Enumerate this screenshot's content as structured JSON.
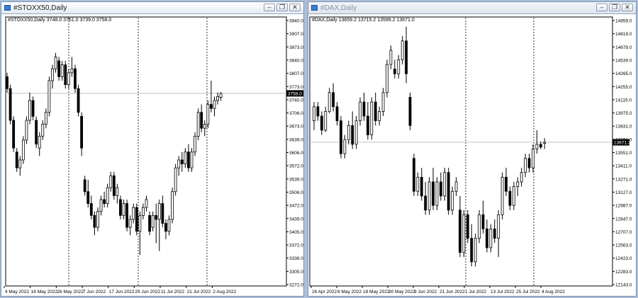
{
  "colors": {
    "desktop": "#abc0d8",
    "chart_bg": "#ffffff",
    "candle": "#000000",
    "grid_separator": "#000000",
    "price_line": "#c0c0c0"
  },
  "windows": [
    {
      "title": "#STOXX50,Daily",
      "info": "#STOXX50,Daily  3748.0 3761.0 3739.0 3758.0",
      "title_buttons": [
        "minimize-icon",
        "restore-icon",
        "close-icon"
      ],
      "price_label": "3758.0",
      "y_ticks": [
        "3940.0",
        "3907.0",
        "3873.0",
        "3840.0",
        "3807.0",
        "3773.0",
        "3740.0",
        "3706.0",
        "3673.0",
        "3639.0",
        "3606.0",
        "3572.0",
        "3539.0",
        "3506.0",
        "3472.0",
        "3439.0",
        "3405.0",
        "3372.0",
        "3338.0",
        "3305.0",
        "3272.0"
      ],
      "x_ticks": [
        "4 May 2022",
        "16 May 2022",
        "26 May 2022",
        "7 Jun 2022",
        "17 Jun 2022",
        "29 Jun 2022",
        "11 Jul 2022",
        "21 Jul 2022",
        "2 Aug 2022"
      ]
    },
    {
      "title": "#DAX,Daily",
      "info": "#DAX,Daily  13659.2 13715.2 13599.2 13671.0",
      "title_buttons": [
        "minimize-icon",
        "restore-icon",
        "close-icon"
      ],
      "price_label": "13671.2",
      "y_ticks": [
        "14959.0",
        "14819.0",
        "14679.0",
        "14539.0",
        "14395.0",
        "14255.0",
        "14115.0",
        "13975.0",
        "13831.0",
        "13691.0",
        "13551.0",
        "13411.0",
        "13271.0",
        "13127.0",
        "12987.0",
        "12847.0",
        "12707.0",
        "12563.0",
        "12423.0",
        "12283.0",
        "12143.0"
      ],
      "x_ticks": [
        "26 Apr 2022",
        "6 May 2022",
        "18 May 2022",
        "30 May 2022",
        "9 Jun 2022",
        "21 Jun 2022",
        "1 Jul 2022",
        "13 Jul 2022",
        "25 Jul 2022",
        "4 Aug 2022"
      ]
    }
  ],
  "chart_data": [
    {
      "type": "candlestick",
      "title": "#STOXX50,Daily",
      "ohlc_header": [
        3748.0,
        3761.0,
        3739.0,
        3758.0
      ],
      "ylim": [
        3272.0,
        3940.0
      ],
      "current_price": 3758.0,
      "bars": [
        [
          3800,
          3810,
          3760,
          3770
        ],
        [
          3770,
          3780,
          3680,
          3690
        ],
        [
          3690,
          3700,
          3610,
          3620
        ],
        [
          3610,
          3620,
          3560,
          3570
        ],
        [
          3570,
          3600,
          3550,
          3590
        ],
        [
          3590,
          3650,
          3580,
          3640
        ],
        [
          3640,
          3700,
          3630,
          3690
        ],
        [
          3690,
          3760,
          3680,
          3740
        ],
        [
          3740,
          3750,
          3690,
          3700
        ],
        [
          3690,
          3700,
          3620,
          3630
        ],
        [
          3620,
          3660,
          3600,
          3650
        ],
        [
          3650,
          3690,
          3640,
          3680
        ],
        [
          3680,
          3720,
          3670,
          3710
        ],
        [
          3710,
          3800,
          3700,
          3790
        ],
        [
          3790,
          3830,
          3770,
          3820
        ],
        [
          3820,
          3860,
          3810,
          3850
        ],
        [
          3840,
          3850,
          3790,
          3800
        ],
        [
          3800,
          3840,
          3790,
          3830
        ],
        [
          3830,
          3840,
          3770,
          3780
        ],
        [
          3780,
          3820,
          3770,
          3810
        ],
        [
          3810,
          3850,
          3800,
          3820
        ],
        [
          3820,
          3830,
          3760,
          3770
        ],
        [
          3770,
          3780,
          3700,
          3710
        ],
        [
          3700,
          3710,
          3600,
          3620
        ],
        [
          3540,
          3550,
          3500,
          3510
        ],
        [
          3510,
          3540,
          3470,
          3480
        ],
        [
          3480,
          3500,
          3440,
          3450
        ],
        [
          3450,
          3460,
          3400,
          3420
        ],
        [
          3420,
          3470,
          3410,
          3460
        ],
        [
          3460,
          3500,
          3450,
          3490
        ],
        [
          3490,
          3510,
          3470,
          3480
        ],
        [
          3480,
          3530,
          3470,
          3520
        ],
        [
          3520,
          3560,
          3510,
          3550
        ],
        [
          3550,
          3560,
          3490,
          3500
        ],
        [
          3500,
          3530,
          3480,
          3520
        ],
        [
          3490,
          3500,
          3440,
          3450
        ],
        [
          3450,
          3490,
          3440,
          3480
        ],
        [
          3480,
          3490,
          3410,
          3420
        ],
        [
          3420,
          3450,
          3400,
          3440
        ],
        [
          3440,
          3480,
          3430,
          3470
        ],
        [
          3470,
          3480,
          3400,
          3410
        ],
        [
          3410,
          3460,
          3350,
          3450
        ],
        [
          3450,
          3480,
          3440,
          3470
        ],
        [
          3470,
          3500,
          3460,
          3490
        ],
        [
          3450,
          3460,
          3400,
          3410
        ],
        [
          3420,
          3460,
          3410,
          3450
        ],
        [
          3450,
          3480,
          3380,
          3440
        ],
        [
          3440,
          3490,
          3360,
          3480
        ],
        [
          3480,
          3500,
          3420,
          3430
        ],
        [
          3430,
          3440,
          3390,
          3410
        ],
        [
          3410,
          3450,
          3400,
          3440
        ],
        [
          3440,
          3520,
          3430,
          3510
        ],
        [
          3510,
          3580,
          3500,
          3570
        ],
        [
          3570,
          3600,
          3550,
          3590
        ],
        [
          3590,
          3610,
          3560,
          3580
        ],
        [
          3580,
          3620,
          3570,
          3610
        ],
        [
          3610,
          3630,
          3560,
          3570
        ],
        [
          3570,
          3620,
          3560,
          3610
        ],
        [
          3610,
          3660,
          3600,
          3650
        ],
        [
          3650,
          3720,
          3640,
          3710
        ],
        [
          3710,
          3730,
          3660,
          3670
        ],
        [
          3670,
          3690,
          3650,
          3680
        ],
        [
          3680,
          3740,
          3670,
          3730
        ],
        [
          3730,
          3790,
          3710,
          3720
        ],
        [
          3720,
          3750,
          3700,
          3740
        ],
        [
          3740,
          3760,
          3730,
          3750
        ],
        [
          3748,
          3761,
          3739,
          3758
        ]
      ]
    },
    {
      "type": "candlestick",
      "title": "#DAX,Daily",
      "ohlc_header": [
        13659.2,
        13715.2,
        13599.2,
        13671.0
      ],
      "ylim": [
        12143.0,
        14959.0
      ],
      "current_price": 13671.2,
      "bars": [
        [
          13900,
          14100,
          13800,
          14050
        ],
        [
          14050,
          14100,
          13900,
          13950
        ],
        [
          13950,
          14000,
          13750,
          13800
        ],
        [
          13800,
          14050,
          13780,
          14000
        ],
        [
          14000,
          14250,
          13980,
          14200
        ],
        [
          14200,
          14300,
          14000,
          14050
        ],
        [
          14050,
          14100,
          13850,
          13900
        ],
        [
          13900,
          13950,
          13500,
          13550
        ],
        [
          13550,
          13750,
          13500,
          13700
        ],
        [
          13700,
          13900,
          13650,
          13850
        ],
        [
          13850,
          14000,
          13600,
          13650
        ],
        [
          13650,
          13950,
          13600,
          13900
        ],
        [
          13900,
          14150,
          13850,
          14100
        ],
        [
          14100,
          14200,
          13900,
          13950
        ],
        [
          13950,
          14100,
          13700,
          13750
        ],
        [
          13750,
          14150,
          13700,
          14100
        ],
        [
          14100,
          14200,
          13850,
          13900
        ],
        [
          13900,
          14050,
          13850,
          14000
        ],
        [
          14000,
          14250,
          13950,
          14200
        ],
        [
          14200,
          14550,
          14150,
          14500
        ],
        [
          14500,
          14700,
          14450,
          14650
        ],
        [
          14450,
          14550,
          14350,
          14400
        ],
        [
          14400,
          14600,
          14350,
          14550
        ],
        [
          14550,
          14800,
          14500,
          14750
        ],
        [
          14750,
          14900,
          14300,
          14400
        ],
        [
          14150,
          14200,
          13800,
          13850
        ],
        [
          13500,
          13550,
          13100,
          13150
        ],
        [
          13150,
          13350,
          13100,
          13300
        ],
        [
          13300,
          13400,
          13050,
          13100
        ],
        [
          13100,
          13250,
          12900,
          12950
        ],
        [
          12950,
          13300,
          12900,
          13250
        ],
        [
          13250,
          13400,
          12950,
          13000
        ],
        [
          13000,
          13300,
          12950,
          13250
        ],
        [
          13250,
          13350,
          13050,
          13100
        ],
        [
          13100,
          13400,
          13050,
          13350
        ],
        [
          13350,
          13400,
          12900,
          12950
        ],
        [
          12950,
          13200,
          12900,
          13150
        ],
        [
          13150,
          13300,
          13100,
          13250
        ],
        [
          12950,
          13100,
          12450,
          12500
        ],
        [
          12500,
          12950,
          12450,
          12900
        ],
        [
          12900,
          12950,
          12600,
          12650
        ],
        [
          12650,
          12800,
          12350,
          12400
        ],
        [
          12400,
          12700,
          12350,
          12650
        ],
        [
          12650,
          12950,
          12600,
          12900
        ],
        [
          12900,
          13050,
          12700,
          12750
        ],
        [
          12750,
          12850,
          12500,
          12550
        ],
        [
          12550,
          12800,
          12500,
          12750
        ],
        [
          12750,
          12850,
          12600,
          12650
        ],
        [
          12650,
          12950,
          12450,
          12900
        ],
        [
          12900,
          13350,
          12850,
          13300
        ],
        [
          13300,
          13400,
          13100,
          13150
        ],
        [
          13150,
          13200,
          12950,
          13000
        ],
        [
          13000,
          13250,
          12950,
          13200
        ],
        [
          13200,
          13300,
          13100,
          13250
        ],
        [
          13250,
          13400,
          13200,
          13350
        ],
        [
          13350,
          13550,
          13300,
          13500
        ],
        [
          13500,
          13550,
          13350,
          13400
        ],
        [
          13400,
          13650,
          13350,
          13600
        ],
        [
          13600,
          13800,
          13550,
          13650
        ],
        [
          13650,
          13680,
          13600,
          13620
        ],
        [
          13659.2,
          13715.2,
          13599.2,
          13671.0
        ]
      ]
    }
  ]
}
